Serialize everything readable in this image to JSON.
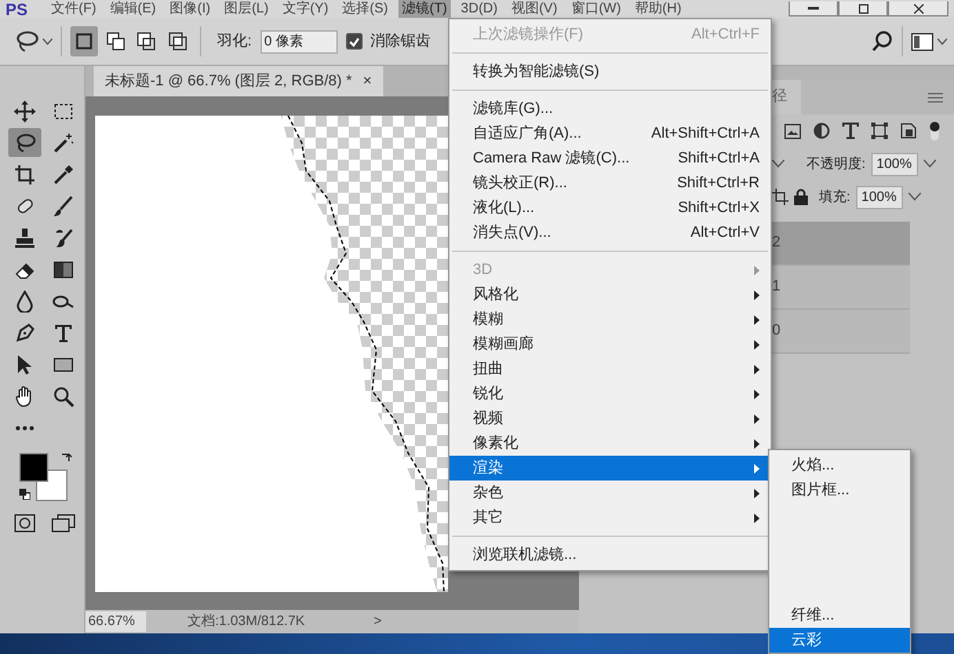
{
  "menubar": {
    "logo": "PS",
    "items": [
      {
        "label": "文件(F)",
        "selected": false
      },
      {
        "label": "编辑(E)",
        "selected": false
      },
      {
        "label": "图像(I)",
        "selected": false
      },
      {
        "label": "图层(L)",
        "selected": false
      },
      {
        "label": "文字(Y)",
        "selected": false
      },
      {
        "label": "选择(S)",
        "selected": false
      },
      {
        "label": "滤镜(T)",
        "selected": true
      },
      {
        "label": "3D(D)",
        "selected": false
      },
      {
        "label": "视图(V)",
        "selected": false
      },
      {
        "label": "窗口(W)",
        "selected": false
      },
      {
        "label": "帮助(H)",
        "selected": false
      }
    ]
  },
  "options_bar": {
    "selection_modes": [
      {
        "kind": "new",
        "selected": true
      },
      {
        "kind": "add",
        "selected": false
      },
      {
        "kind": "subtract",
        "selected": false
      },
      {
        "kind": "intersect",
        "selected": false
      }
    ],
    "feather_label": "羽化:",
    "feather_value": "0 像素",
    "anti_alias": {
      "label": "消除锯齿",
      "checked": true
    }
  },
  "document_tab": {
    "title": "未标题-1 @ 66.7% (图层 2, RGB/8) *",
    "close": "×"
  },
  "tools": [
    {
      "kind": "move",
      "selected": false
    },
    {
      "kind": "marquee",
      "selected": false
    },
    {
      "kind": "lasso",
      "selected": true
    },
    {
      "kind": "wand",
      "selected": false
    },
    {
      "kind": "crop",
      "selected": false
    },
    {
      "kind": "eyedropper",
      "selected": false
    },
    {
      "kind": "heal",
      "selected": false
    },
    {
      "kind": "brush",
      "selected": false
    },
    {
      "kind": "stamp",
      "selected": false
    },
    {
      "kind": "history",
      "selected": false
    },
    {
      "kind": "eraser",
      "selected": false
    },
    {
      "kind": "gradient",
      "selected": false
    },
    {
      "kind": "blur",
      "selected": false
    },
    {
      "kind": "dodge",
      "selected": false
    },
    {
      "kind": "pen",
      "selected": false
    },
    {
      "kind": "type",
      "selected": false
    },
    {
      "kind": "select",
      "selected": false
    },
    {
      "kind": "shape",
      "selected": false
    },
    {
      "kind": "hand",
      "selected": false
    },
    {
      "kind": "zoom",
      "selected": false
    },
    {
      "kind": "more",
      "selected": false
    }
  ],
  "status_bar": {
    "zoom": "66.67%",
    "doc_info": "文档:1.03M/812.7K",
    "arrow": ">"
  },
  "layers_panel": {
    "tab_label": "径",
    "opacity_label": "不透明度:",
    "opacity_value": "100%",
    "fill_label": "填充:",
    "fill_value": "100%",
    "layers": [
      {
        "name": "2",
        "selected": true
      },
      {
        "name": "1",
        "selected": false
      },
      {
        "name": "0",
        "selected": false
      }
    ]
  },
  "filter_menu": {
    "items": [
      {
        "kind": "item",
        "label": "上次滤镜操作(F)",
        "shortcut": "Alt+Ctrl+F",
        "disabled": true,
        "submenu": false,
        "selected": false
      },
      {
        "kind": "separator"
      },
      {
        "kind": "item",
        "label": "转换为智能滤镜(S)",
        "disabled": false,
        "submenu": false,
        "selected": false
      },
      {
        "kind": "separator"
      },
      {
        "kind": "item",
        "label": "滤镜库(G)...",
        "disabled": false,
        "submenu": false,
        "selected": false
      },
      {
        "kind": "item",
        "label": "自适应广角(A)...",
        "shortcut": "Alt+Shift+Ctrl+A",
        "disabled": false,
        "submenu": false,
        "selected": false
      },
      {
        "kind": "item",
        "label": "Camera Raw 滤镜(C)...",
        "shortcut": "Shift+Ctrl+A",
        "disabled": false,
        "submenu": false,
        "selected": false
      },
      {
        "kind": "item",
        "label": "镜头校正(R)...",
        "shortcut": "Shift+Ctrl+R",
        "disabled": false,
        "submenu": false,
        "selected": false
      },
      {
        "kind": "item",
        "label": "液化(L)...",
        "shortcut": "Shift+Ctrl+X",
        "disabled": false,
        "submenu": false,
        "selected": false
      },
      {
        "kind": "item",
        "label": "消失点(V)...",
        "shortcut": "Alt+Ctrl+V",
        "disabled": false,
        "submenu": false,
        "selected": false
      },
      {
        "kind": "separator"
      },
      {
        "kind": "item",
        "label": "3D",
        "disabled": true,
        "submenu": true,
        "selected": false
      },
      {
        "kind": "item",
        "label": "风格化",
        "disabled": false,
        "submenu": true,
        "selected": false
      },
      {
        "kind": "item",
        "label": "模糊",
        "disabled": false,
        "submenu": true,
        "selected": false
      },
      {
        "kind": "item",
        "label": "模糊画廊",
        "disabled": false,
        "submenu": true,
        "selected": false
      },
      {
        "kind": "item",
        "label": "扭曲",
        "disabled": false,
        "submenu": true,
        "selected": false
      },
      {
        "kind": "item",
        "label": "锐化",
        "disabled": false,
        "submenu": true,
        "selected": false
      },
      {
        "kind": "item",
        "label": "视频",
        "disabled": false,
        "submenu": true,
        "selected": false
      },
      {
        "kind": "item",
        "label": "像素化",
        "disabled": false,
        "submenu": true,
        "selected": false
      },
      {
        "kind": "item",
        "label": "渲染",
        "disabled": false,
        "submenu": true,
        "selected": true
      },
      {
        "kind": "item",
        "label": "杂色",
        "disabled": false,
        "submenu": true,
        "selected": false
      },
      {
        "kind": "item",
        "label": "其它",
        "disabled": false,
        "submenu": true,
        "selected": false
      },
      {
        "kind": "separator"
      },
      {
        "kind": "item",
        "label": "浏览联机滤镜...",
        "disabled": false,
        "submenu": false,
        "selected": false
      }
    ]
  },
  "render_submenu": {
    "top_items": [
      {
        "label": "火焰...",
        "selected": false
      },
      {
        "label": "图片框...",
        "selected": false
      }
    ],
    "bottom_items": [
      {
        "label": "纤维...",
        "selected": false
      },
      {
        "label": "云彩",
        "selected": true
      }
    ]
  }
}
